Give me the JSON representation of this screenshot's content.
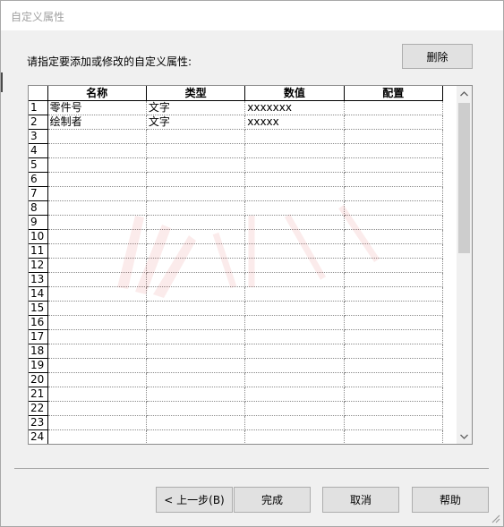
{
  "window": {
    "title": "自定义属性"
  },
  "prompt": "请指定要添加或修改的自定义属性:",
  "toolbar": {
    "delete_label": "删除"
  },
  "table": {
    "columns": [
      "名称",
      "类型",
      "数值",
      "配置"
    ],
    "rows": [
      {
        "num": "1",
        "name": "零件号",
        "type": "文字",
        "value": "xxxxxxx",
        "config": ""
      },
      {
        "num": "2",
        "name": "绘制者",
        "type": "文字",
        "value": "xxxxx",
        "config": ""
      },
      {
        "num": "3",
        "name": "",
        "type": "",
        "value": "",
        "config": ""
      },
      {
        "num": "4",
        "name": "",
        "type": "",
        "value": "",
        "config": ""
      },
      {
        "num": "5",
        "name": "",
        "type": "",
        "value": "",
        "config": ""
      },
      {
        "num": "6",
        "name": "",
        "type": "",
        "value": "",
        "config": ""
      },
      {
        "num": "7",
        "name": "",
        "type": "",
        "value": "",
        "config": ""
      },
      {
        "num": "8",
        "name": "",
        "type": "",
        "value": "",
        "config": ""
      },
      {
        "num": "9",
        "name": "",
        "type": "",
        "value": "",
        "config": ""
      },
      {
        "num": "10",
        "name": "",
        "type": "",
        "value": "",
        "config": ""
      },
      {
        "num": "11",
        "name": "",
        "type": "",
        "value": "",
        "config": ""
      },
      {
        "num": "12",
        "name": "",
        "type": "",
        "value": "",
        "config": ""
      },
      {
        "num": "13",
        "name": "",
        "type": "",
        "value": "",
        "config": ""
      },
      {
        "num": "14",
        "name": "",
        "type": "",
        "value": "",
        "config": ""
      },
      {
        "num": "15",
        "name": "",
        "type": "",
        "value": "",
        "config": ""
      },
      {
        "num": "16",
        "name": "",
        "type": "",
        "value": "",
        "config": ""
      },
      {
        "num": "17",
        "name": "",
        "type": "",
        "value": "",
        "config": ""
      },
      {
        "num": "18",
        "name": "",
        "type": "",
        "value": "",
        "config": ""
      },
      {
        "num": "19",
        "name": "",
        "type": "",
        "value": "",
        "config": ""
      },
      {
        "num": "20",
        "name": "",
        "type": "",
        "value": "",
        "config": ""
      },
      {
        "num": "21",
        "name": "",
        "type": "",
        "value": "",
        "config": ""
      },
      {
        "num": "22",
        "name": "",
        "type": "",
        "value": "",
        "config": ""
      },
      {
        "num": "23",
        "name": "",
        "type": "",
        "value": "",
        "config": ""
      },
      {
        "num": "24",
        "name": "",
        "type": "",
        "value": "",
        "config": ""
      }
    ]
  },
  "scrollbar": {
    "up_icon": "chevron-up-icon",
    "down_icon": "chevron-down-icon"
  },
  "footer": {
    "back_label": "< 上一步(B)",
    "finish_label": "完成",
    "cancel_label": "取消",
    "help_label": "帮助"
  }
}
